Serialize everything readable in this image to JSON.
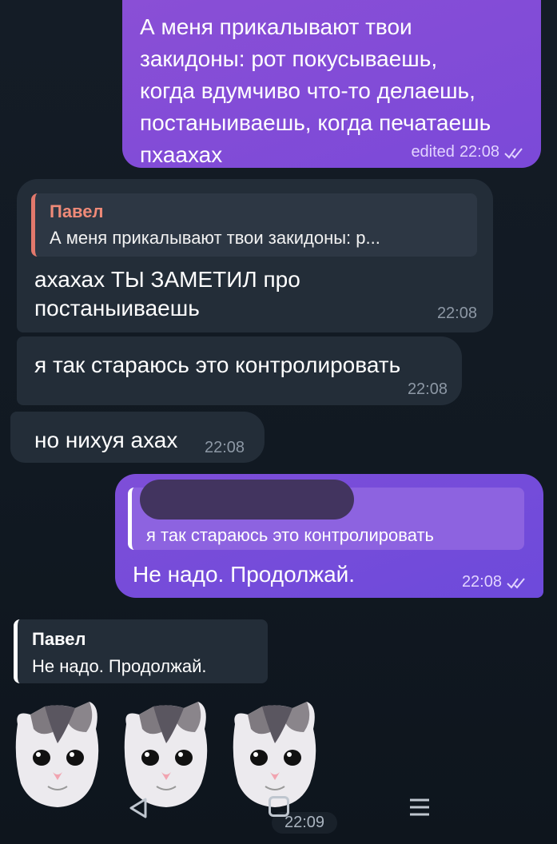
{
  "messages": [
    {
      "direction": "outgoing",
      "lines": [
        "А меня прикалывают твои",
        "закидоны: рот покусываешь,",
        "когда вдумчиво что-то делаешь,",
        "постаныиваешь, когда печатаешь",
        "пхаахах"
      ],
      "status": "edited",
      "time": "22:08",
      "read_icon": "double-check-icon"
    },
    {
      "direction": "incoming",
      "reply": {
        "author": "Павел",
        "text": "А меня прикалывают твои закидоны: р..."
      },
      "lines": [
        "ахахах ТЫ ЗАМЕТИЛ про",
        "постаныиваешь"
      ],
      "time": "22:08"
    },
    {
      "direction": "incoming",
      "text": "я так стараюсь это контролировать",
      "time": "22:08"
    },
    {
      "direction": "incoming",
      "text": "но нихуя ахах",
      "time": "22:08"
    },
    {
      "direction": "outgoing",
      "reply": {
        "author": "",
        "text": "я так стараюсь это контролировать"
      },
      "text": "Не надо. Продолжай.",
      "time": "22:08",
      "read_icon": "double-check-icon"
    }
  ],
  "sticker_reply": {
    "author": "Павел",
    "text": "Не надо. Продолжай.",
    "sticker_icon": "crying-cat-icon",
    "count": 3,
    "time": "22:09"
  },
  "navbar": {
    "back_icon": "back-triangle-icon",
    "home_icon": "home-square-icon",
    "menu_icon": "menu-lines-icon"
  },
  "colors": {
    "background": "#121a23",
    "outgoing_bubble": "#8a4fd6",
    "incoming_bubble": "#232d38",
    "reply_accent": "#e2786c"
  }
}
